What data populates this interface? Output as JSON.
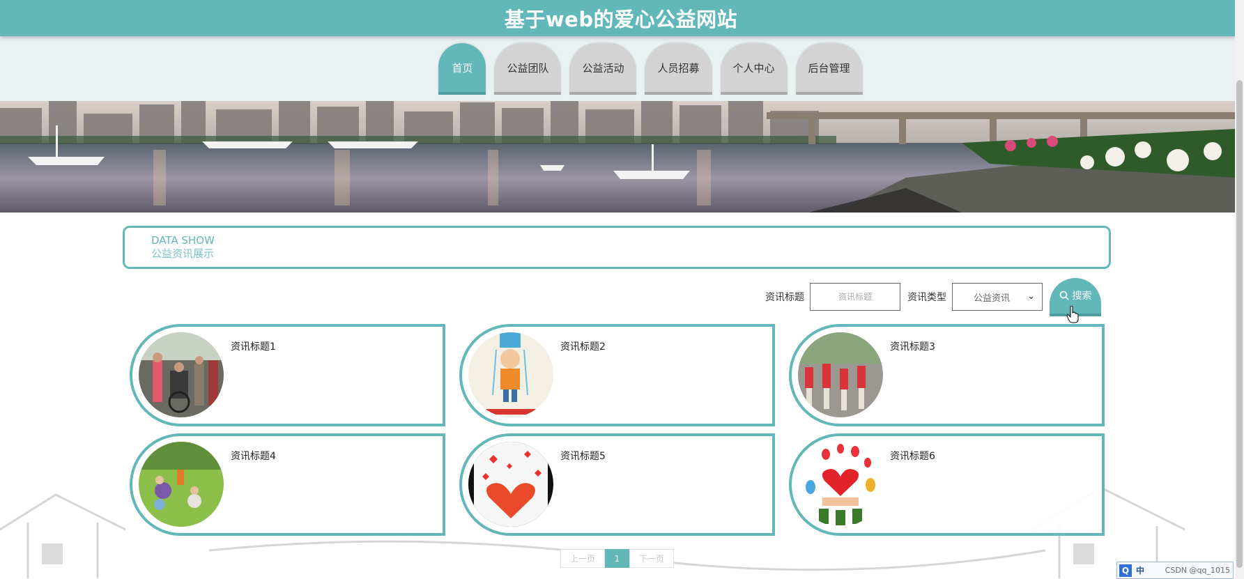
{
  "app": {
    "site_title": "基于web的爱心公益网站"
  },
  "nav": {
    "items": [
      {
        "label": "首页",
        "active": true
      },
      {
        "label": "公益团队",
        "active": false
      },
      {
        "label": "公益活动",
        "active": false
      },
      {
        "label": "人员招募",
        "active": false
      },
      {
        "label": "个人中心",
        "active": false
      },
      {
        "label": "后台管理",
        "active": false
      }
    ]
  },
  "section": {
    "en_title": "DATA SHOW",
    "cn_title": "公益资讯展示"
  },
  "search": {
    "title_label": "资讯标题",
    "title_placeholder": "资讯标题",
    "type_label": "资讯类型",
    "type_selected": "公益资讯",
    "button_label": "搜索",
    "button_icon": "search-icon"
  },
  "cards": [
    {
      "title": "资讯标题1",
      "image": "crowd-street-photo"
    },
    {
      "title": "资讯标题2",
      "image": "ice-bucket-challenge-photo"
    },
    {
      "title": "资讯标题3",
      "image": "red-shirts-group-photo"
    },
    {
      "title": "资讯标题4",
      "image": "volunteers-on-grass-photo"
    },
    {
      "title": "资讯标题5",
      "image": "heart-hands-butterflies-photo"
    },
    {
      "title": "资讯标题6",
      "image": "hearts-balloons-photo"
    }
  ],
  "pagination": {
    "prev": "上一页",
    "current": "1",
    "next": "下一页"
  },
  "tray": {
    "ime_label": "中",
    "watermark": "CSDN @qq_1015"
  },
  "colors": {
    "accent": "#62b7b9",
    "nav_inactive": "#d3d3d3"
  }
}
